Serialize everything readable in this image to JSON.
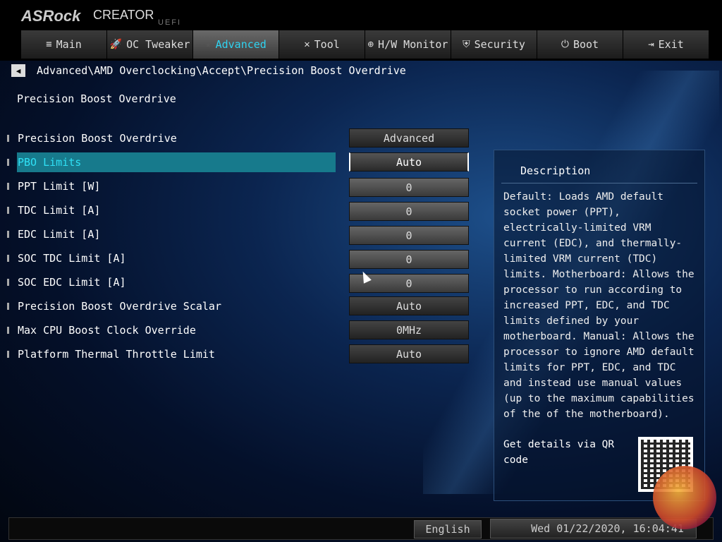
{
  "header": {
    "logo": "ASRock",
    "product": "CREATOR",
    "uefi": "UEFI"
  },
  "tabs": [
    {
      "label": "Main",
      "icon": "≡"
    },
    {
      "label": "OC Tweaker",
      "icon": "🚀"
    },
    {
      "label": "Advanced",
      "icon": "★"
    },
    {
      "label": "Tool",
      "icon": "✕"
    },
    {
      "label": "H/W Monitor",
      "icon": "⊕"
    },
    {
      "label": "Security",
      "icon": "⛨"
    },
    {
      "label": "Boot",
      "icon": "⏻"
    },
    {
      "label": "Exit",
      "icon": "⇥"
    }
  ],
  "breadcrumb": "Advanced\\AMD Overclocking\\Accept\\Precision Boost Overdrive",
  "page_title": "Precision Boost Overdrive",
  "settings": [
    {
      "label": "Precision Boost Overdrive",
      "value": "Advanced"
    },
    {
      "label": "PBO Limits",
      "value": "Auto"
    },
    {
      "label": "PPT Limit [W]",
      "value": "0"
    },
    {
      "label": "TDC Limit [A]",
      "value": "0"
    },
    {
      "label": "EDC Limit [A]",
      "value": "0"
    },
    {
      "label": "SOC TDC Limit [A]",
      "value": "0"
    },
    {
      "label": "SOC EDC Limit [A]",
      "value": "0"
    },
    {
      "label": "Precision Boost Overdrive Scalar",
      "value": "Auto"
    },
    {
      "label": "Max CPU Boost Clock Override",
      "value": "0MHz"
    },
    {
      "label": "Platform Thermal Throttle Limit",
      "value": "Auto"
    }
  ],
  "description": {
    "title": "Description",
    "text": "Default: Loads AMD default socket power (PPT), electrically-limited VRM current (EDC), and thermally-limited VRM current (TDC) limits. Motherboard: Allows the processor to run according to increased PPT, EDC, and TDC limits defined by your motherboard. Manual: Allows the processor to ignore AMD default limits for PPT, EDC, and TDC and instead use manual values (up to the maximum capabilities of the of the motherboard).",
    "qr_text": "Get details via QR code"
  },
  "status": {
    "language": "English",
    "datetime": "Wed 01/22/2020, 16:04:41"
  }
}
